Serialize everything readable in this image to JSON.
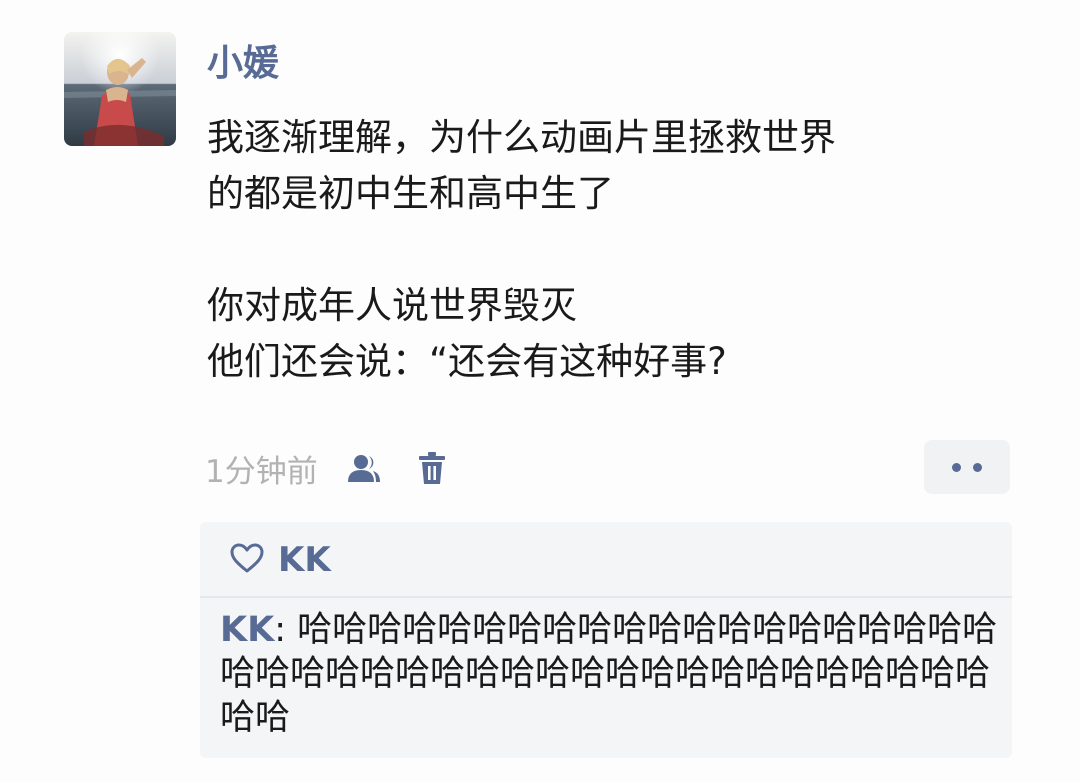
{
  "post": {
    "author": "小媛",
    "paragraphs": [
      [
        "我逐渐理解，为什么动画片里拯救世界",
        "的都是初中生和高中生了"
      ],
      [
        "你对成年人说世界毁灭",
        "他们还会说：“还会有这种好事?"
      ]
    ],
    "timestamp": "1分钟前",
    "icons": {
      "privacy": "friends-visibility-icon",
      "delete": "trash-icon",
      "more": "more-dots-icon",
      "like": "heart-outline-icon"
    }
  },
  "likes": {
    "names": "KK"
  },
  "comments": [
    {
      "author": "KK",
      "separator": ": ",
      "text": "哈哈哈哈哈哈哈哈哈哈哈哈哈哈哈哈哈哈哈哈哈哈哈哈哈哈哈哈哈哈哈哈哈哈哈哈哈哈哈哈哈哈哈哈"
    }
  ],
  "colors": {
    "link": "#576b95",
    "text": "#1a1a1a",
    "meta": "#b2b2b2",
    "panel": "#f4f5f7"
  }
}
